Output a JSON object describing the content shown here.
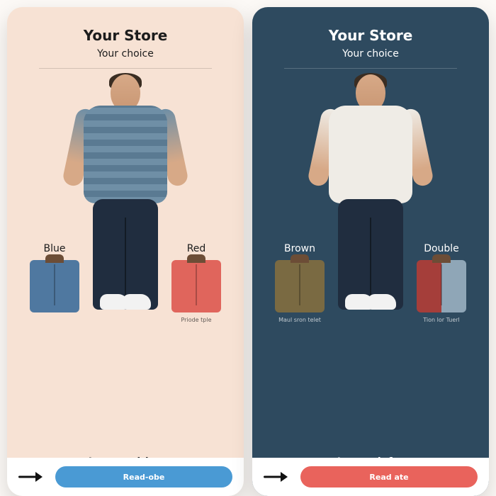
{
  "panels": [
    {
      "theme": "light",
      "title": "Your Store",
      "subtitle": "Your choice",
      "swatch_left": {
        "label": "Blue",
        "style": "blue",
        "caption": ""
      },
      "swatch_right": {
        "label": "Red",
        "style": "red",
        "caption": "Priode tple"
      },
      "tagline": "Loverestition",
      "cta_label": "Read-obe",
      "cta_color": "blue"
    },
    {
      "theme": "dark",
      "title": "Your Store",
      "subtitle": "Your choice",
      "swatch_left": {
        "label": "Brown",
        "style": "brown",
        "caption": "Maul sron telet"
      },
      "swatch_right": {
        "label": "Double",
        "style": "double",
        "caption": "Tion lor Tuerl"
      },
      "tagline": "Loweath for",
      "cta_label": "Read ate",
      "cta_color": "red"
    }
  ]
}
